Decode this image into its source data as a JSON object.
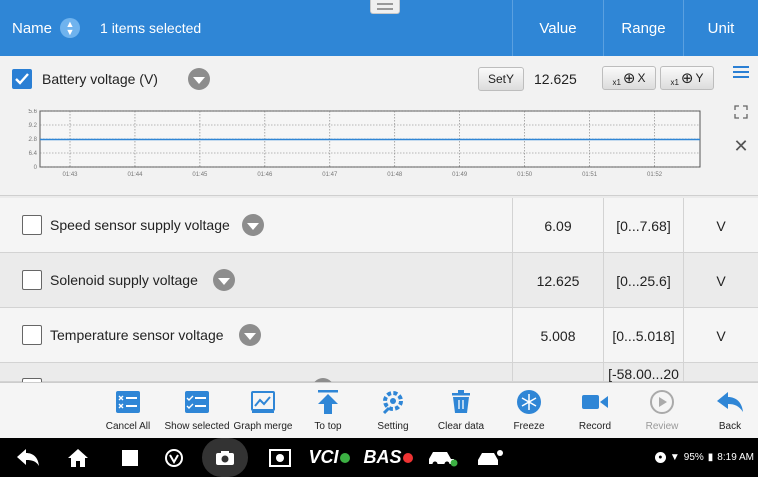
{
  "header": {
    "name_label": "Name",
    "selected_text": "1 items selected",
    "value_label": "Value",
    "range_label": "Range",
    "unit_label": "Unit"
  },
  "graph_row": {
    "label": "Battery voltage  (V)",
    "checked": true,
    "sety_label": "SetY",
    "value": "12.625",
    "zoom_x_label": "X",
    "zoom_y_label": "Y",
    "zoom_mult": "x1"
  },
  "chart_data": {
    "type": "line",
    "x": [
      "01:43",
      "01:44",
      "01:45",
      "01:46",
      "01:47",
      "01:48",
      "01:49",
      "01:50",
      "01:51",
      "01:52"
    ],
    "y_ticks": [
      "25.6",
      "19.2",
      "12.8",
      "6.4",
      "0"
    ],
    "ylim": [
      0,
      25.6
    ],
    "series": [
      {
        "values": [
          12.6,
          12.6,
          12.6,
          12.6,
          12.6,
          12.6,
          12.6,
          12.6,
          12.6,
          12.6,
          12.6
        ]
      }
    ],
    "color": "#2f86d6"
  },
  "rows": [
    {
      "label": "Speed sensor supply voltage",
      "value": "6.09",
      "range": "[0...7.68]",
      "unit": "V"
    },
    {
      "label": "Solenoid supply voltage",
      "value": "12.625",
      "range": "[0...25.6]",
      "unit": "V"
    },
    {
      "label": "Temperature sensor voltage",
      "value": "5.008",
      "range": "[0...5.018]",
      "unit": "V"
    },
    {
      "label": "",
      "value": "",
      "range": "[-58.00...20",
      "unit": ""
    }
  ],
  "toolbar": [
    {
      "label": "Cancel All",
      "icon": "cancel-all-icon"
    },
    {
      "label": "Show selected",
      "icon": "show-selected-icon"
    },
    {
      "label": "Graph merge",
      "icon": "graph-merge-icon"
    },
    {
      "label": "To top",
      "icon": "to-top-icon"
    },
    {
      "label": "Setting",
      "icon": "setting-icon"
    },
    {
      "label": "Clear data",
      "icon": "clear-data-icon"
    },
    {
      "label": "Freeze",
      "icon": "freeze-icon"
    },
    {
      "label": "Record",
      "icon": "record-icon"
    },
    {
      "label": "Review",
      "icon": "review-icon"
    },
    {
      "label": "Back",
      "icon": "back-icon"
    }
  ],
  "navbar": {
    "vci_text": "VCI",
    "bas_text": "BAS",
    "battery_text": "95%",
    "time_text": "8:19 AM"
  },
  "colors": {
    "accent": "#2f86d6",
    "header": "#2f86d6"
  }
}
